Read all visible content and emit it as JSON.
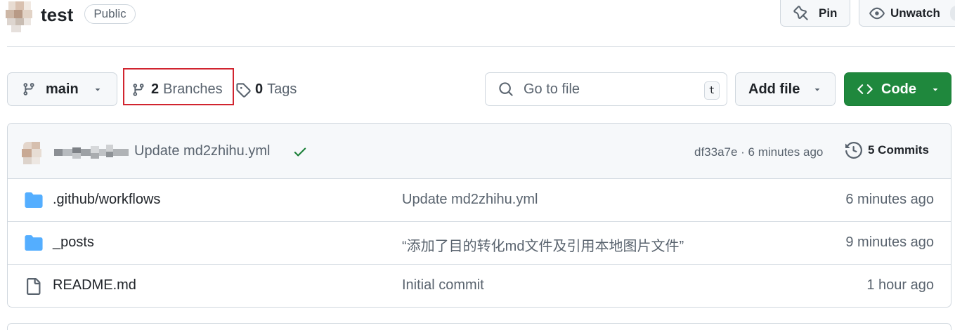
{
  "repo": {
    "name": "test",
    "visibility": "Public"
  },
  "header_actions": {
    "pin_label": "Pin",
    "unwatch_label": "Unwatch"
  },
  "toolbar": {
    "branch_label": "main",
    "branches_count": "2",
    "branches_label": "Branches",
    "tags_count": "0",
    "tags_label": "Tags",
    "search_placeholder": "Go to file",
    "search_shortcut": "t",
    "add_file_label": "Add file",
    "code_label": "Code"
  },
  "latest_commit": {
    "message": "Update md2zhihu.yml",
    "sha_time": "df33a7e · 6 minutes ago",
    "commits_label": "5 Commits"
  },
  "files": [
    {
      "type": "folder",
      "name": ".github/workflows",
      "message": "Update md2zhihu.yml",
      "time": "6 minutes ago"
    },
    {
      "type": "folder",
      "name": "_posts",
      "message": "“添加了目的转化md文件及引用本地图片文件”",
      "time": "9 minutes ago"
    },
    {
      "type": "file",
      "name": "README.md",
      "message": "Initial commit",
      "time": "1 hour ago"
    }
  ],
  "colors": {
    "accent_green": "#1f883d",
    "highlight_red": "#d1242f",
    "folder_blue": "#54aeff",
    "muted_text": "#59636e"
  }
}
